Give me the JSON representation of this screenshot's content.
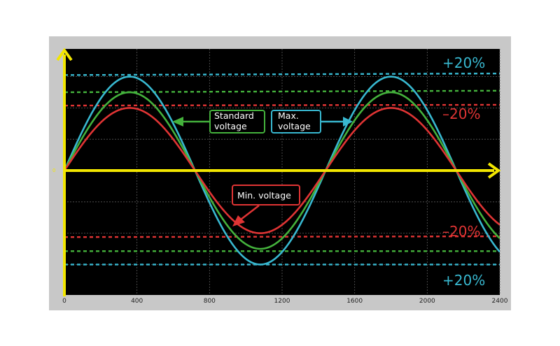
{
  "colors": {
    "background": "#000000",
    "frame": "#c8c8c8",
    "axis": "#f2e600",
    "max": "#38b8d0",
    "standard": "#44b23c",
    "min": "#e03434",
    "grid": "#5a5a5a"
  },
  "chart_data": {
    "type": "line",
    "title": "",
    "xlabel": "",
    "ylabel": "",
    "xlim": [
      0,
      2400
    ],
    "ylim": [
      -1.6,
      1.6
    ],
    "x_ticks": [
      "0",
      "400",
      "800",
      "1200",
      "1600",
      "2000",
      "2400"
    ],
    "y_axis_marker": "0",
    "grid": true,
    "series": [
      {
        "key": "max",
        "type": "sine",
        "amplitude": 1.2,
        "period": 1440,
        "color": "#38b8d0"
      },
      {
        "key": "standard",
        "type": "sine",
        "amplitude": 1.0,
        "period": 1440,
        "color": "#44b23c"
      },
      {
        "key": "min",
        "type": "sine",
        "amplitude": 0.8,
        "period": 1440,
        "color": "#e03434"
      }
    ],
    "reference_lines": [
      {
        "key": "max-upper",
        "y": 1.22,
        "slope": 0.02,
        "color": "#38b8d0"
      },
      {
        "key": "standard-upper",
        "y": 1.0,
        "slope": 0.02,
        "color": "#44b23c"
      },
      {
        "key": "min-upper",
        "y": 0.83,
        "slope": 0.01,
        "color": "#e03434"
      },
      {
        "key": "min-lower",
        "y": -0.85,
        "slope": 0.01,
        "color": "#e03434"
      },
      {
        "key": "standard-lower",
        "y": -1.03,
        "slope": 0.0,
        "color": "#44b23c"
      },
      {
        "key": "max-lower",
        "y": -1.2,
        "slope": 0.0,
        "color": "#38b8d0"
      }
    ],
    "annotations": {
      "plus_top": "+20%",
      "minus_top": "–20%",
      "minus_bottom": "–20%",
      "plus_bottom": "+20%",
      "standard_line1": "Standard",
      "standard_line2": "voltage",
      "max_line1": "Max.",
      "max_line2": "voltage",
      "min_label": "Min. voltage"
    }
  }
}
